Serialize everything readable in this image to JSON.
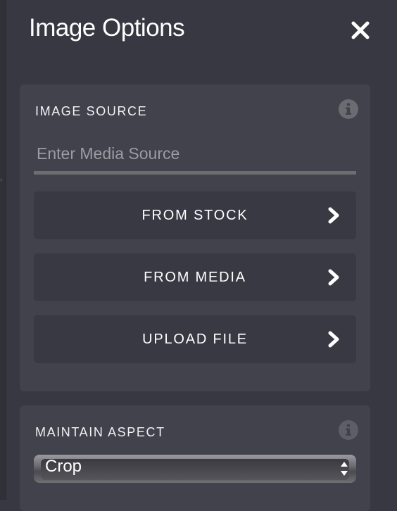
{
  "panel": {
    "title": "Image Options",
    "close_icon": "close-icon"
  },
  "image_source": {
    "label": "IMAGE SOURCE",
    "info_icon": "info-icon",
    "input_value": "",
    "input_placeholder": "Enter Media Source",
    "buttons": [
      {
        "label": "FROM STOCK",
        "icon": "chevron-right-icon"
      },
      {
        "label": "FROM MEDIA",
        "icon": "chevron-right-icon"
      },
      {
        "label": "UPLOAD FILE",
        "icon": "chevron-right-icon"
      }
    ]
  },
  "maintain_aspect": {
    "label": "MAINTAIN ASPECT",
    "info_icon": "info-icon",
    "selected": "Crop"
  },
  "colors": {
    "background": "#373841",
    "card": "#41424b",
    "button": "#383943",
    "text": "#ffffff",
    "input_underline": "#6e6e72"
  }
}
